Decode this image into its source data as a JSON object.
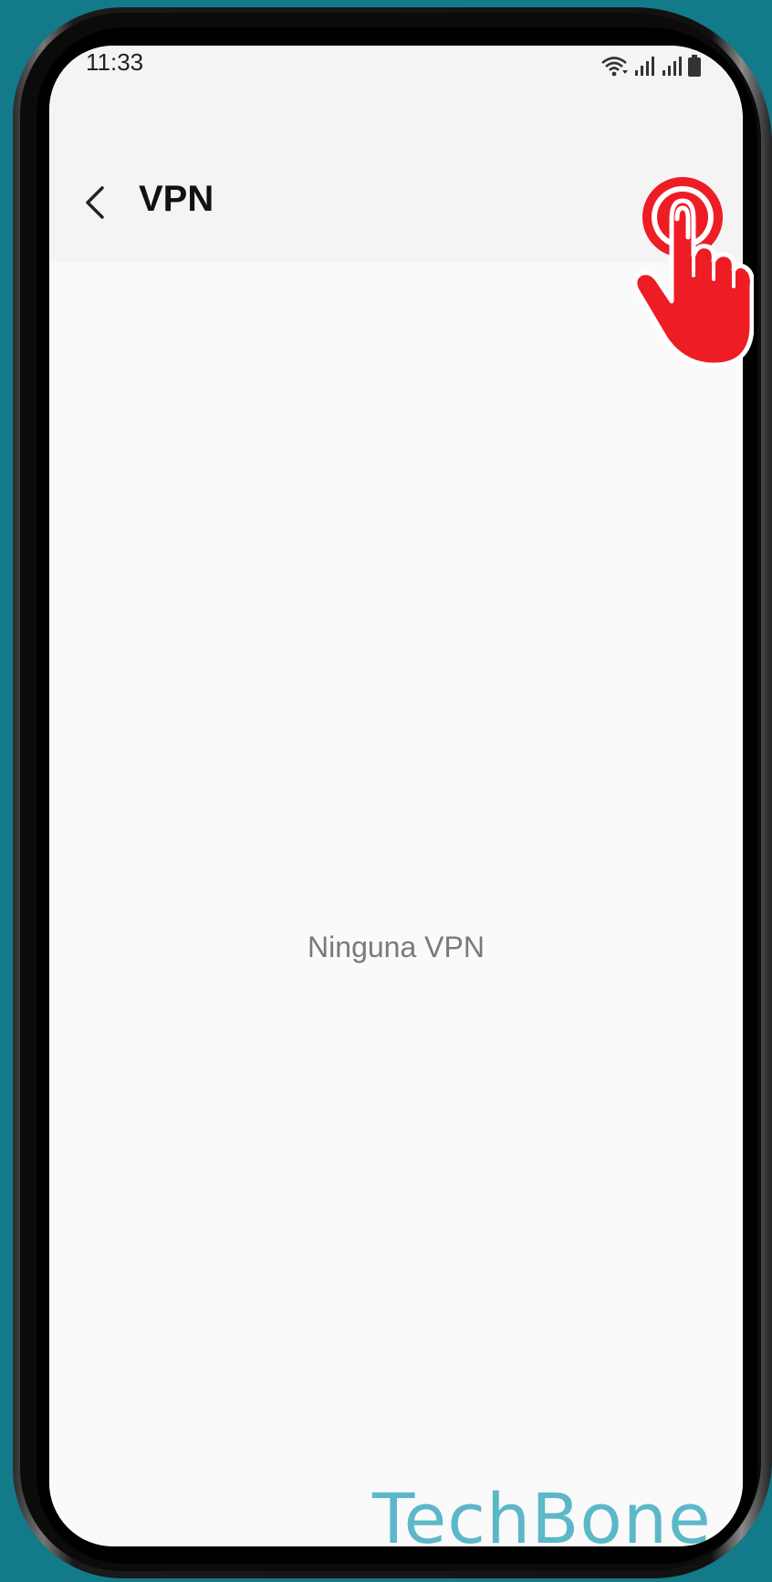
{
  "status_bar": {
    "time": "11:33",
    "icons": [
      "wifi-icon",
      "signal-icon",
      "signal-icon",
      "battery-icon"
    ]
  },
  "header": {
    "back_icon": "chevron-left-icon",
    "title": "VPN",
    "more_icon": "more-vertical-icon"
  },
  "main": {
    "empty_message": "Ninguna VPN"
  },
  "overlay": {
    "tap_indicator_icon": "tap-hand-icon",
    "watermark": "TechBone"
  },
  "colors": {
    "background": "#137a8a",
    "tap_indicator": "#ee1c24",
    "watermark": "#5cb8c8"
  }
}
